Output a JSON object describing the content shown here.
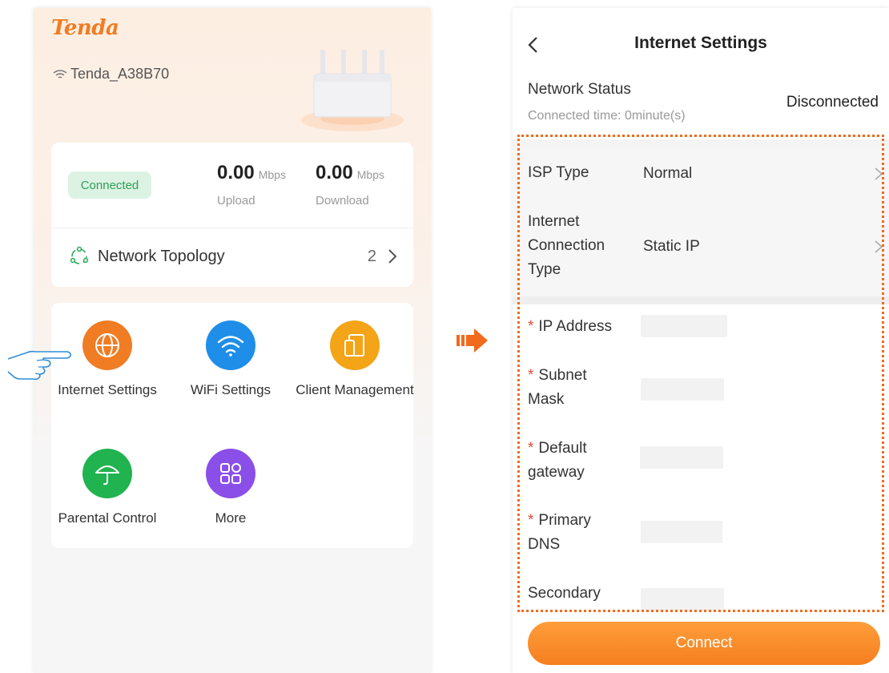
{
  "left_panel": {
    "logo": "Tenda",
    "ssid": "Tenda_A38B70",
    "status_badge": "Connected",
    "upload": {
      "value": "0.00",
      "unit": "Mbps",
      "label": "Upload"
    },
    "download": {
      "value": "0.00",
      "unit": "Mbps",
      "label": "Download"
    },
    "topology": {
      "label": "Network Topology",
      "count": "2"
    },
    "apps": [
      {
        "label": "Internet Settings",
        "icon": "globe-icon",
        "color": "#f07c23"
      },
      {
        "label": "WiFi Settings",
        "icon": "wifi-icon",
        "color": "#1e8ee8"
      },
      {
        "label": "Client Management",
        "icon": "devices-icon",
        "color": "#f3a417"
      },
      {
        "label": "Parental Control",
        "icon": "umbrella-icon",
        "color": "#21b34f"
      },
      {
        "label": "More",
        "icon": "grid-icon",
        "color": "#8a4fe8"
      }
    ]
  },
  "right_panel": {
    "title": "Internet Settings",
    "network_status": {
      "label": "Network Status",
      "connected_time": "Connected time: 0minute(s)",
      "value": "Disconnected"
    },
    "isp_type": {
      "label": "ISP Type",
      "value": "Normal"
    },
    "connection_type": {
      "label_lines": [
        "Internet",
        "Connection",
        "Type"
      ],
      "value": "Static IP"
    },
    "fields": {
      "ip_address": {
        "label": "IP Address",
        "value": ""
      },
      "subnet_mask": {
        "label_lines": [
          "Subnet",
          "Mask"
        ],
        "value": ""
      },
      "default_gateway": {
        "label_lines": [
          "Default",
          "gateway"
        ],
        "value": ""
      },
      "primary_dns": {
        "label_lines": [
          "Primary",
          "DNS"
        ],
        "value": ""
      },
      "secondary_dns": {
        "label": "Secondary",
        "value": ""
      }
    },
    "required_mark": "*",
    "connect_label": "Connect"
  },
  "colors": {
    "accent": "#f07c23",
    "highlight_border": "#f26a1b",
    "connected_green": "#2f9d57"
  }
}
